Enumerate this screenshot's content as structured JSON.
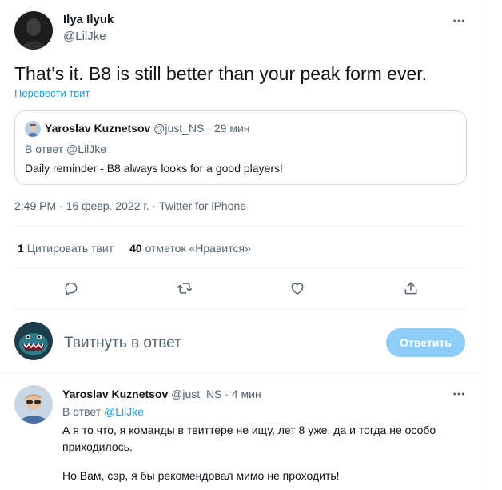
{
  "tweet": {
    "author_name": "Ilya Ilyuk",
    "author_handle": "@LilJke",
    "text": "That’s it. B8 is still better than your peak form ever.",
    "translate_label": "Перевести твит",
    "timestamp": "2:49 PM · 16 февр. 2022 г. · Twitter for iPhone"
  },
  "quote": {
    "author_name": "Yaroslav Kuznetsov",
    "author_handle": "@just_NS",
    "time": "29 мин",
    "reply_to": "В ответ @LilJke",
    "text": "Daily reminder - B8 always looks for a good players!"
  },
  "stats": {
    "quotes_count": "1",
    "quotes_label": "Цитировать твит",
    "likes_count": "40",
    "likes_label": "отметок «Нравится»"
  },
  "actions": [
    "reply-icon",
    "retweet-icon",
    "like-icon",
    "share-icon"
  ],
  "compose": {
    "placeholder": "Твитнуть в ответ",
    "button_label": "Ответить"
  },
  "reply": {
    "author_name": "Yaroslav Kuznetsov",
    "author_handle": "@just_NS",
    "time": "4 мин",
    "reply_prefix": "В ответ",
    "reply_mention": "@LilJke",
    "text_1": "А я то что, я команды в твиттере не ищу, лет 8 уже, да и тогда не особо приходилось.",
    "text_2": "Но Вам, сэр, я бы рекомендовал мимо не проходить!"
  },
  "colors": {
    "accent": "#1d9bf0",
    "button_disabled": "#8ecdf8",
    "secondary_text": "#536471"
  }
}
